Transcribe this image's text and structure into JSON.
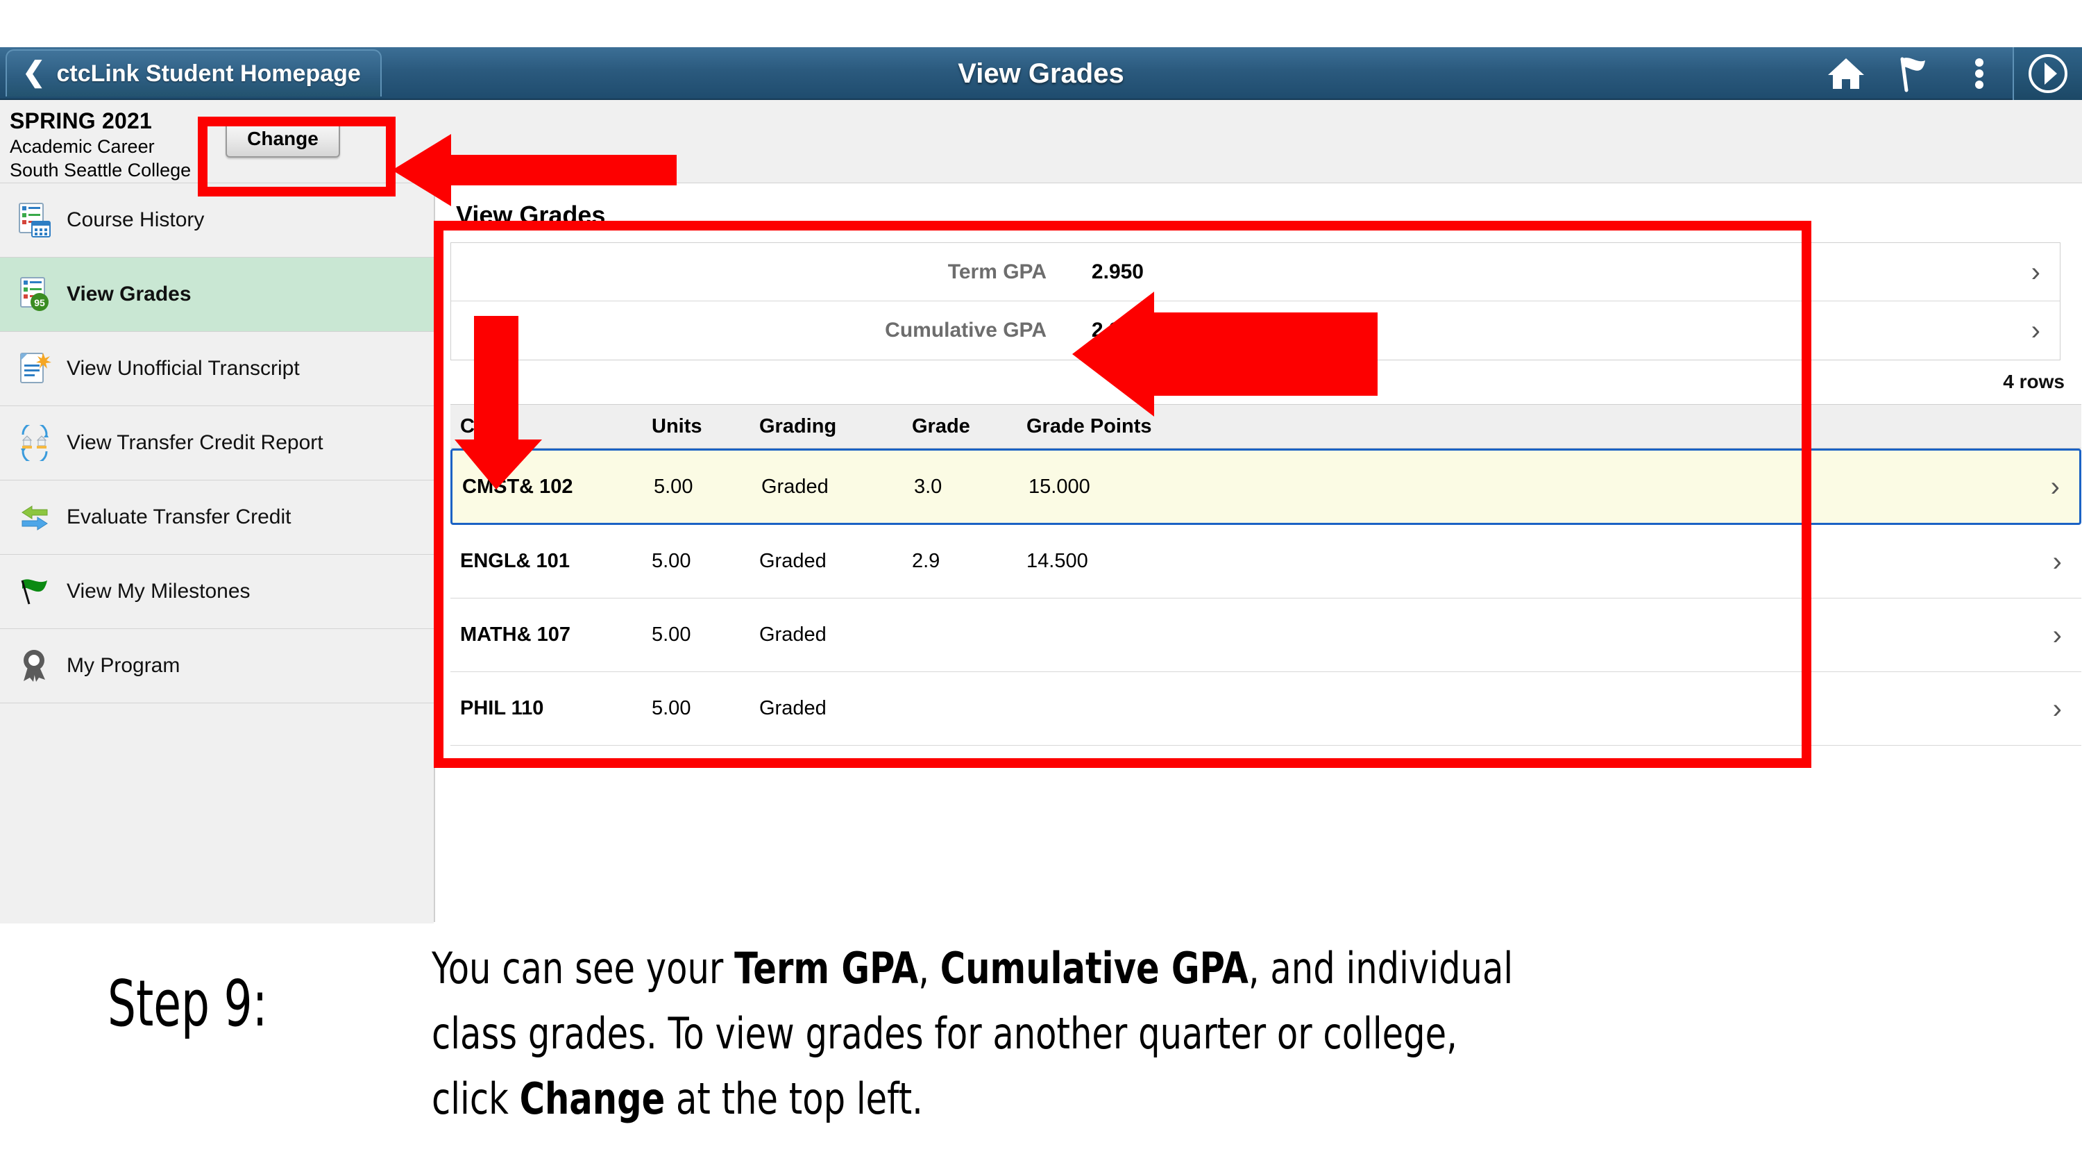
{
  "header": {
    "back_label": "ctcLink Student Homepage",
    "title": "View Grades",
    "icons": [
      "home-icon",
      "flag-icon",
      "kebab-menu-icon",
      "nav-bar-icon"
    ]
  },
  "term_bar": {
    "term": "SPRING 2021",
    "career": "Academic Career",
    "institution": "South Seattle College",
    "change_label": "Change"
  },
  "sidebar": {
    "items": [
      {
        "label": "Course History",
        "icon": "course-history-icon",
        "active": false
      },
      {
        "label": "View Grades",
        "icon": "view-grades-icon",
        "active": true
      },
      {
        "label": "View Unofficial Transcript",
        "icon": "transcript-icon",
        "active": false
      },
      {
        "label": "View Transfer Credit Report",
        "icon": "transfer-credit-report-icon",
        "active": false
      },
      {
        "label": "Evaluate Transfer Credit",
        "icon": "evaluate-transfer-icon",
        "active": false
      },
      {
        "label": "View My Milestones",
        "icon": "green-flag-icon",
        "active": false
      },
      {
        "label": "My Program",
        "icon": "ribbon-award-icon",
        "active": false
      }
    ]
  },
  "content": {
    "title": "View Grades",
    "gpa": [
      {
        "label": "Term GPA",
        "value": "2.950"
      },
      {
        "label": "Cumulative GPA",
        "value": "2.950"
      }
    ],
    "rows_count": "4 rows",
    "table": {
      "columns": [
        "Class",
        "Units",
        "Grading",
        "Grade",
        "Grade Points"
      ],
      "rows": [
        {
          "class": "CMST& 102",
          "units": "5.00",
          "grading": "Graded",
          "grade": "3.0",
          "points": "15.000",
          "selected": true
        },
        {
          "class": "ENGL& 101",
          "units": "5.00",
          "grading": "Graded",
          "grade": "2.9",
          "points": "14.500",
          "selected": false
        },
        {
          "class": "MATH& 107",
          "units": "5.00",
          "grading": "Graded",
          "grade": "",
          "points": "",
          "selected": false
        },
        {
          "class": "PHIL 110",
          "units": "5.00",
          "grading": "Graded",
          "grade": "",
          "points": "",
          "selected": false
        }
      ]
    }
  },
  "caption": {
    "step": "Step 9:",
    "line1_a": "You can see your ",
    "line1_b": "Term GPA",
    "line1_c": ", ",
    "line1_d": "Cumulative GPA",
    "line1_e": ", and individual",
    "line2": "class grades.  To view grades for another quarter or college,",
    "line3_a": "click ",
    "line3_b": "Change",
    "line3_c": " at the top left."
  },
  "colors": {
    "header_blue": "#2b5a7e",
    "annotation_red": "#fd0000",
    "sidebar_active_green": "#c9e7d3",
    "selected_row_yellow": "#fbfbe4",
    "selected_row_border_blue": "#1b62c4"
  }
}
